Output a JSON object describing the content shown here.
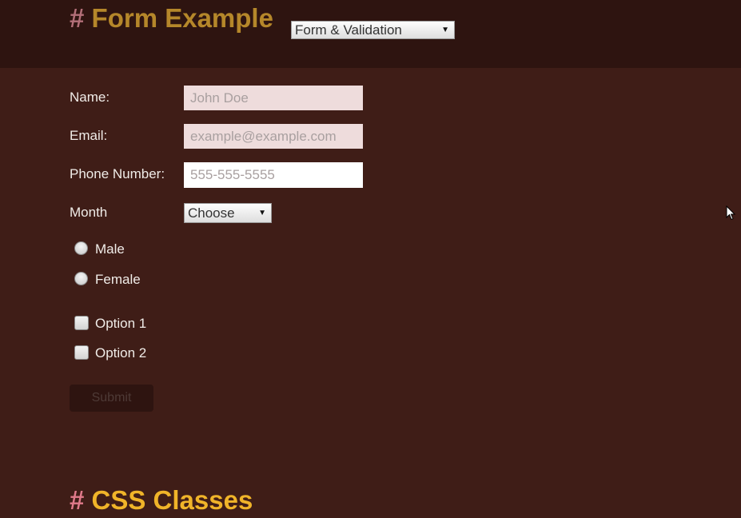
{
  "header": {
    "hash": "#",
    "title": "Form Example",
    "nav_select": {
      "selected": "Form & Validation"
    }
  },
  "form": {
    "name": {
      "label": "Name:",
      "placeholder": "John Doe"
    },
    "email": {
      "label": "Email:",
      "placeholder": "example@example.com"
    },
    "phone": {
      "label": "Phone Number:",
      "placeholder": "555-555-5555"
    },
    "month": {
      "label": "Month",
      "selected": "Choose"
    },
    "gender": [
      {
        "label": "Male"
      },
      {
        "label": "Female"
      }
    ],
    "options": [
      {
        "label": "Option 1"
      },
      {
        "label": "Option 2"
      }
    ],
    "submit_label": "Submit"
  },
  "next_section": {
    "hash": "#",
    "title": "CSS Classes"
  },
  "icons": {
    "dropdown": "triangle-down",
    "cursor": "mouse-pointer"
  }
}
